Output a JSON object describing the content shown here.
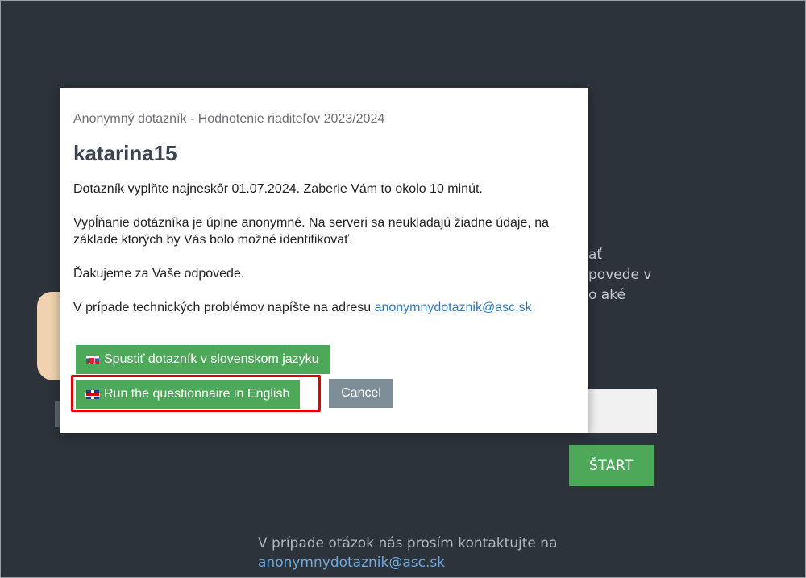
{
  "background": {
    "side_text": [
      "ať",
      "povede v",
      "o aké"
    ],
    "start_label": "ŠTART",
    "footer_text": "V prípade otázok nás prosím kontaktujte na",
    "footer_email": "anonymnydotaznik@asc.sk"
  },
  "modal": {
    "subtitle": "Anonymný dotazník - Hodnotenie riaditeľov 2023/2024",
    "title": "katarina15",
    "p1": "Dotazník vyplňte najneskôr 01.07.2024. Zaberie Vám to okolo 10 minút.",
    "p2": "Vypĺňanie dotázníka je úplne anonymné. Na serveri sa neukladajú žiadne údaje, na základe ktorých by Vás bolo možné identifikovať.",
    "p3": "Ďakujeme za Vaše odpovede.",
    "p4_text": "V prípade technických problémov napíšte na adresu",
    "p4_email": "anonymnydotaznik@asc.sk",
    "btn_sk": "Spustiť dotazník v slovenskom jazyku",
    "btn_en": "Run the questionnaire in English",
    "btn_cancel": "Cancel"
  },
  "colors": {
    "background": "#2d333b",
    "green": "#4ea85a",
    "cancel": "#7d8e99",
    "highlight": "#e00000",
    "link": "#2f7bbf"
  },
  "icons": [
    "slovakia-flag-icon",
    "uk-flag-icon"
  ]
}
